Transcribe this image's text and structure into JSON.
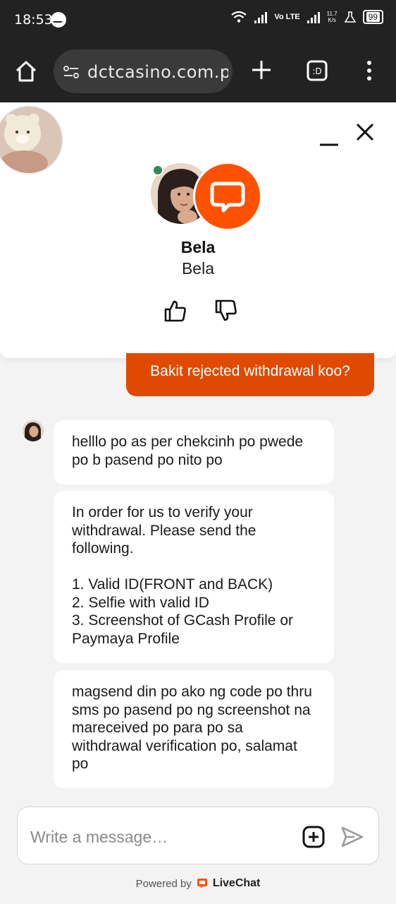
{
  "status_bar": {
    "time": "18:53",
    "network": "Vo LTE",
    "speed_top": "11.7",
    "speed_bottom": "K/s",
    "battery": "99"
  },
  "browser": {
    "url": "dctcasino.com.ph/"
  },
  "agent": {
    "name": "Bela",
    "title": "Bela",
    "status": "online"
  },
  "messages": [
    {
      "from": "visitor",
      "text": "Bakit rejected withdrawal koo?"
    },
    {
      "from": "agent",
      "text": "helllo po as per chekcinh po pwede po b pasend po nito po"
    },
    {
      "from": "agent",
      "text": "In order for us to verify your withdrawal. Please send the following.\n\n1. Valid ID(FRONT and BACK)\n2. Selfie with valid ID\n3. Screenshot of GCash Profile or Paymaya Profile"
    },
    {
      "from": "agent",
      "text": "magsend din po ako ng code po thru sms po pasend po ng screenshot na mareceived po para po sa withdrawal verification po, salamat po"
    }
  ],
  "composer": {
    "placeholder": "Write a message…"
  },
  "footer": {
    "powered_by": "Powered by",
    "brand": "LiveChat"
  },
  "colors": {
    "accent": "#ff5100",
    "visitor_bubble": "#e04a00",
    "online": "#2e8b57",
    "browser_chrome": "#222222"
  }
}
